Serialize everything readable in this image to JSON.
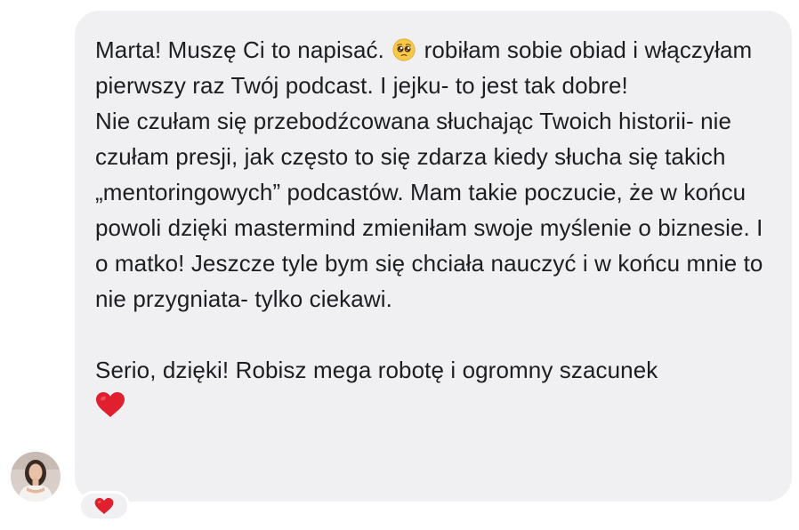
{
  "message": {
    "line1_before_emoji": "Marta! Muszę Ci to napisać.",
    "emoji_icon": "pleading-face-icon",
    "line1_after_emoji": "robiłam sobie obiad i",
    "para1_rest": "włączyłam pierwszy raz Twój podcast. I jejku- to jest tak dobre!",
    "para2": "Nie czułam się przebodźcowana słuchając Twoich historii- nie czułam presji, jak często to się zdarza kiedy słucha się takich „mentoringowych” podcastów. Mam takie poczucie, że w końcu powoli dzięki mastermind zmieniłam swoje myślenie o biznesie. I o matko! Jeszcze tyle bym się chciała nauczyć i w końcu mnie to nie przygniata- tylko ciekawi.",
    "para3": "Serio, dzięki! Robisz mega robotę i ogromny szacunek",
    "trailing_emoji": "red-heart-icon"
  },
  "reaction": {
    "icon": "red-heart-icon"
  },
  "colors": {
    "bubble": "#f0f0f3",
    "text": "#1c1e21",
    "heart": "#e0202e"
  }
}
